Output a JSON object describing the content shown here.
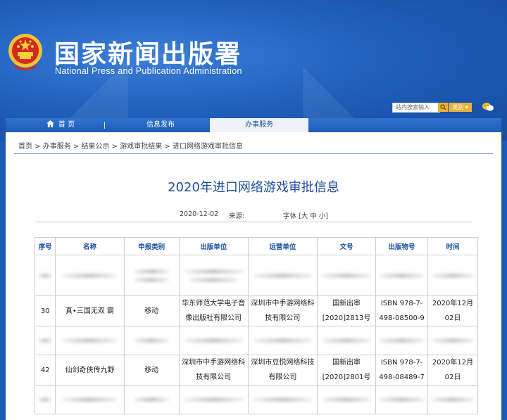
{
  "header": {
    "title": "国家新闻出版署",
    "subtitle": "National Press and Publication Administration",
    "search_placeholder": "站内搜索输入",
    "search_icon": "search-icon",
    "category_label": "类别 ▾"
  },
  "nav": {
    "home": "首 页",
    "info": "信息发布",
    "service": "办事服务"
  },
  "breadcrumb": "首页 > 办事服务 > 结果公示 > 游戏审批结果 > 进口网络游戏审批信息",
  "article": {
    "title": "2020年进口网络游戏审批信息",
    "date": "2020-12-02",
    "source_label": "来源:",
    "font_label": "字体 [大 中 小]"
  },
  "table": {
    "headers": [
      "序号",
      "名称",
      "申报类别",
      "出版单位",
      "运营单位",
      "文号",
      "出版物号",
      "时间"
    ],
    "rows": [
      {
        "no": "30",
        "name": "真•三国无双 霸",
        "category": "移动",
        "publisher": "华东师范大学电子音像出版社有限公司",
        "operator": "深圳市中手游网络科技有限公司",
        "doc_no": "国新出审[2020]2813号",
        "isbn": "ISBN 978-7-498-08500-9",
        "date": "2020年12月02日"
      },
      {
        "no": "42",
        "name": "仙剑奇侠传九野",
        "category": "移动",
        "publisher": "深圳市中手游网络科技有限公司",
        "operator": "深圳市豆悦网络科技有限公司",
        "doc_no": "国新出审[2020]2801号",
        "isbn": "ISBN 978-7-498-08489-7",
        "date": "2020年12月02日"
      }
    ]
  },
  "colors": {
    "brand_blue": "#1f5db7",
    "title_blue": "#1d4f9e",
    "accent_gold": "#e8b23a"
  }
}
